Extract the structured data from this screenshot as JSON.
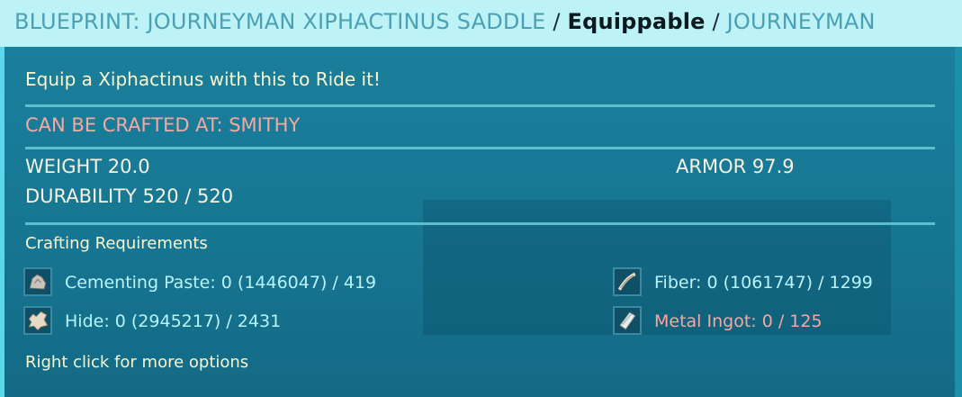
{
  "header": {
    "item_name": "BLUEPRINT: JOURNEYMAN XIPHACTINUS SADDLE",
    "separator": "/",
    "type_tag": "Equippable",
    "quality": "JOURNEYMAN"
  },
  "tooltip": {
    "description": "Equip a Xiphactinus with this to Ride it!",
    "crafted_at": "CAN BE CRAFTED AT: SMITHY",
    "stats": {
      "weight": "WEIGHT 20.0",
      "armor": "ARMOR 97.9",
      "durability": "DURABILITY 520 / 520"
    },
    "requirements_title": "Crafting Requirements",
    "requirements": [
      {
        "icon": "cementing-paste-icon",
        "label": "Cementing Paste: 0 (1446047) / 419",
        "met": true
      },
      {
        "icon": "fiber-icon",
        "label": "Fiber: 0 (1061747) / 1299",
        "met": true
      },
      {
        "icon": "hide-icon",
        "label": "Hide: 0 (2945217) / 2431",
        "met": true
      },
      {
        "icon": "metal-ingot-icon",
        "label": "Metal Ingot: 0 / 125",
        "met": false
      }
    ],
    "hint": "Right click for more options"
  },
  "colors": {
    "header_bg": "#bdf2f7",
    "panel_bg": "#1a7f9c",
    "text_cream": "#fcf6cf",
    "text_red": "#f3a9a2",
    "text_cyan": "#b8f4f7"
  }
}
